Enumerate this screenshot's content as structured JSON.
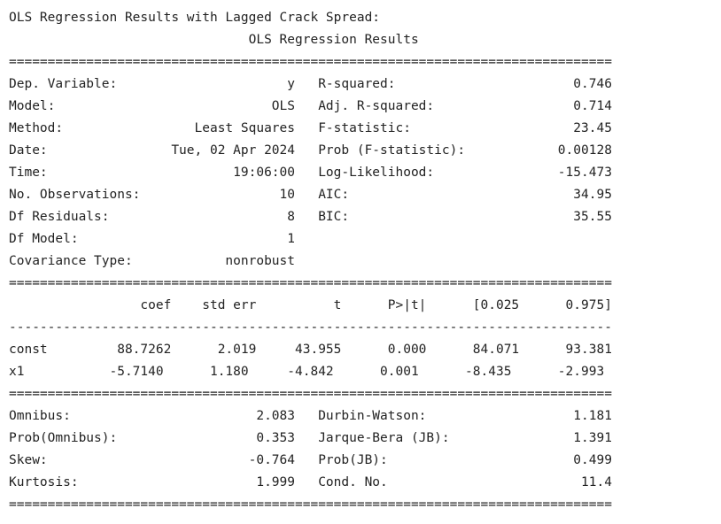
{
  "output": {
    "heading": "OLS Regression Results with Lagged Crack Spread:",
    "lines": [
      "                               OLS Regression Results                            ",
      "==============================================================================",
      "Dep. Variable:                      y   R-squared:                       0.746",
      "Model:                            OLS   Adj. R-squared:                  0.714",
      "Method:                 Least Squares   F-statistic:                     23.45",
      "Date:                Tue, 02 Apr 2024   Prob (F-statistic):            0.00128",
      "Time:                        19:06:00   Log-Likelihood:                -15.473",
      "No. Observations:                  10   AIC:                             34.95",
      "Df Residuals:                       8   BIC:                             35.55",
      "Df Model:                           1                                         ",
      "Covariance Type:            nonrobust                                         ",
      "==============================================================================",
      "                 coef    std err          t      P>|t|      [0.025      0.975]",
      "------------------------------------------------------------------------------",
      "const         88.7262      2.019     43.955      0.000      84.071      93.381",
      "x1           -5.7140      1.180     -4.842      0.001      -8.435      -2.993",
      "==============================================================================",
      "Omnibus:                        2.083   Durbin-Watson:                   1.181",
      "Prob(Omnibus):                  0.353   Jarque-Bera (JB):                1.391",
      "Skew:                          -0.764   Prob(JB):                        0.499",
      "Kurtosis:                       1.999   Cond. No.                         11.4",
      "=============================================================================="
    ]
  }
}
